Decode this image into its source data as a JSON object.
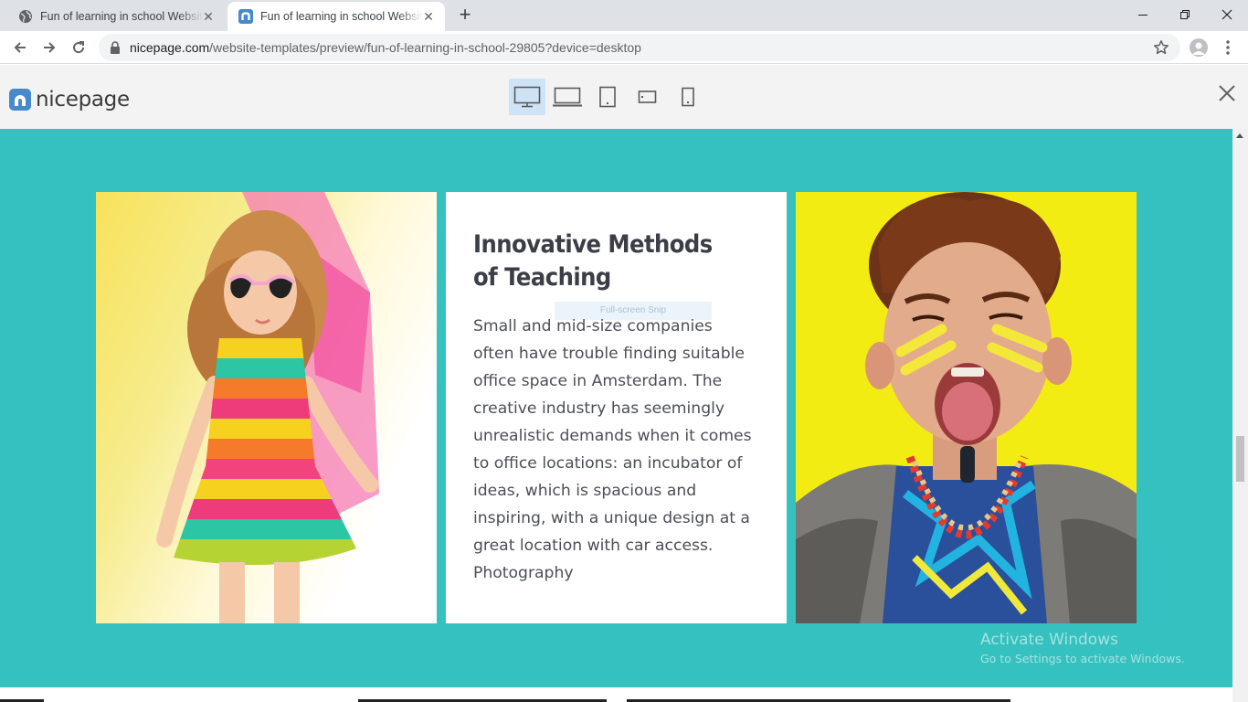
{
  "browser": {
    "tabs": [
      {
        "title": "Fun of learning in school Website",
        "active": false,
        "favicon": "globe-icon"
      },
      {
        "title": "Fun of learning in school Website",
        "active": true,
        "favicon": "nicepage-favicon"
      }
    ],
    "new_tab_label": "+",
    "address": {
      "host": "nicepage.com",
      "path": "/website-templates/preview/fun-of-learning-in-school-29805?device=desktop"
    }
  },
  "preview_header": {
    "logo_text": "nicepage",
    "devices": [
      {
        "name": "desktop",
        "selected": true
      },
      {
        "name": "laptop",
        "selected": false
      },
      {
        "name": "tablet",
        "selected": false
      },
      {
        "name": "phone-landscape",
        "selected": false
      },
      {
        "name": "phone",
        "selected": false
      }
    ]
  },
  "section": {
    "background_color": "#35c1bf",
    "heading_line1": "Innovative Methods",
    "heading_line2": "of Teaching",
    "body": "Small and mid-size companies often have trouble finding suitable office space in Amsterdam. The creative industry has seemingly unrealistic demands when it comes to office locations: an incubator of ideas, which is spacious and inspiring, with a unique design at a great location with car access.",
    "caption": "Photography",
    "snip_overlay": "Full-screen Snip"
  },
  "watermark": {
    "line1": "Activate Windows",
    "line2": "Go to Settings to activate Windows."
  },
  "colors": {
    "accent": "#478ac9",
    "teal": "#35c1bf",
    "yellow": "#f2ec13"
  }
}
